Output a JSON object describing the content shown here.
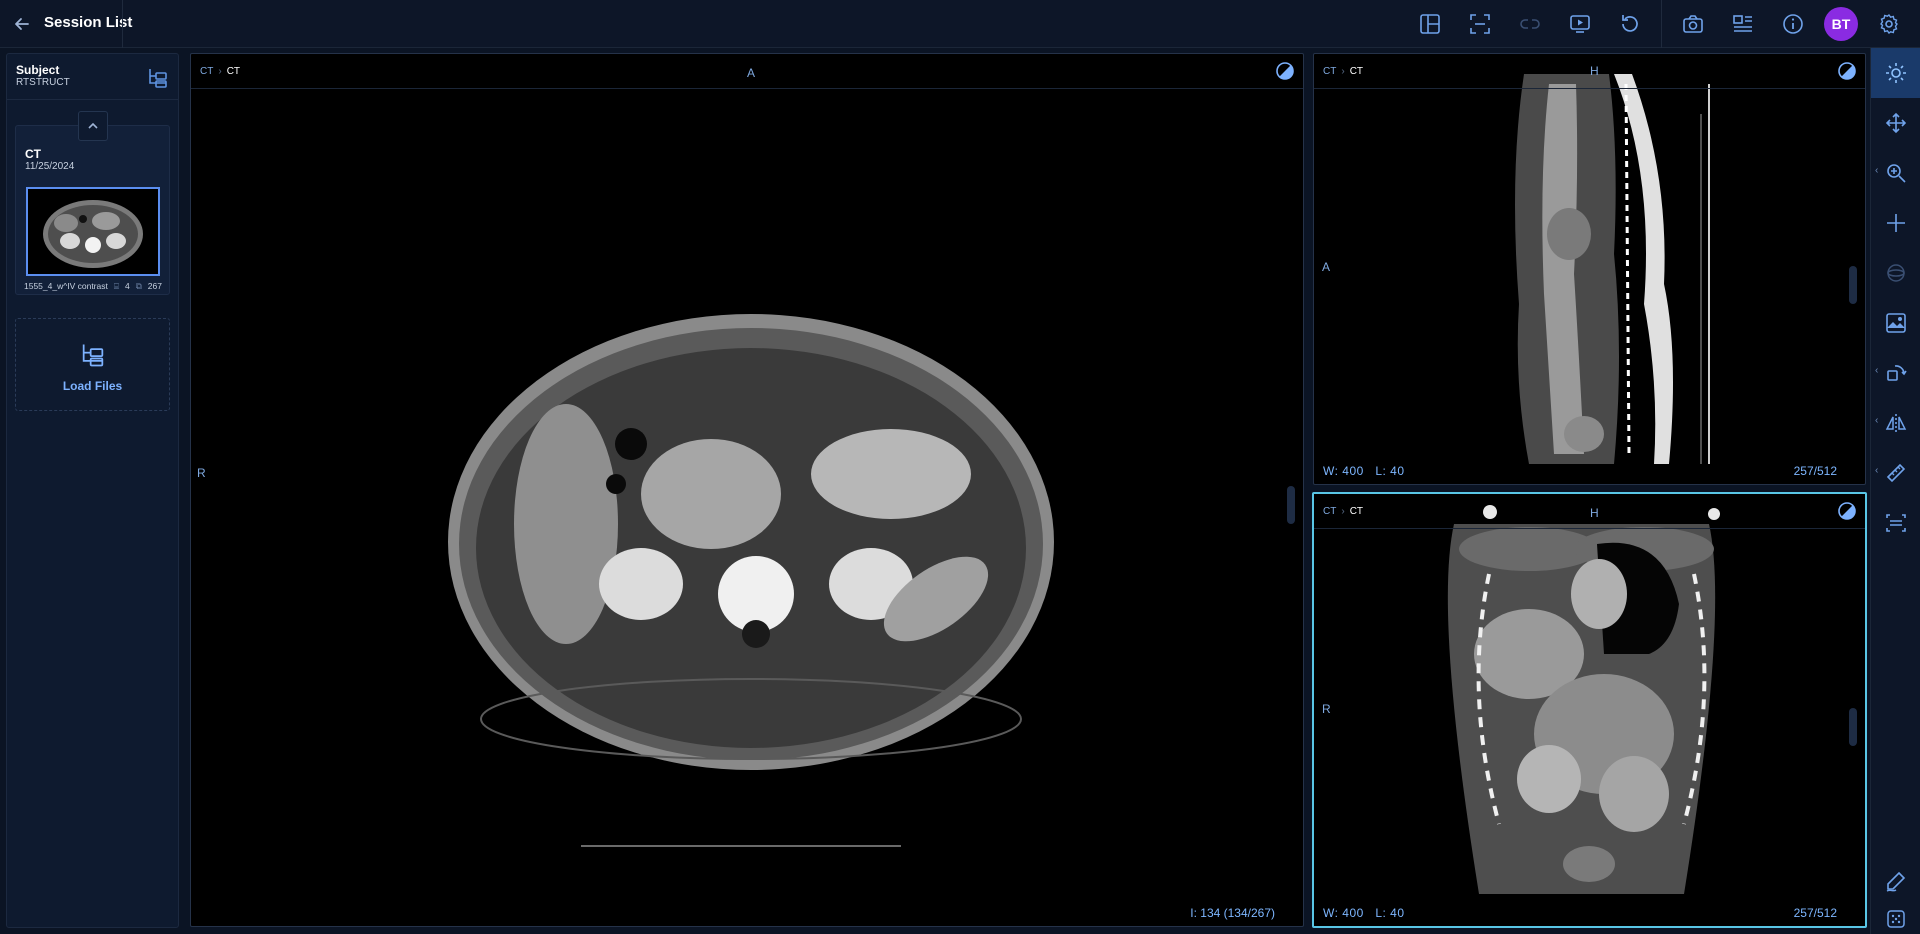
{
  "header": {
    "title": "Session List",
    "avatar_initials": "BT"
  },
  "left_panel": {
    "subject_title": "Subject",
    "subject_subtitle": "RTSTRUCT",
    "study": {
      "modality": "CT",
      "date": "11/25/2024",
      "series_name": "1555_4_w^IV contrast",
      "series_count": "4",
      "image_count": "267"
    },
    "load_files_label": "Load Files"
  },
  "viewports": {
    "axial": {
      "crumb_parent": "CT",
      "crumb_current": "CT",
      "orient_top": "A",
      "orient_left": "R",
      "slice_info": "I: 134 (134/267)"
    },
    "sagittal": {
      "crumb_parent": "CT",
      "crumb_current": "CT",
      "orient_top": "H",
      "orient_left": "A",
      "window": "W:  400",
      "level": "L:  40",
      "slice_info": "257/512"
    },
    "coronal": {
      "crumb_parent": "CT",
      "crumb_current": "CT",
      "orient_top": "H",
      "orient_left": "R",
      "window": "W:  400",
      "level": "L:  40",
      "slice_info": "257/512"
    }
  },
  "colors": {
    "accent": "#59c6e6",
    "link": "#7db2ff",
    "avatar": "#8a2be2",
    "active_tool": "#1a3a6a"
  }
}
